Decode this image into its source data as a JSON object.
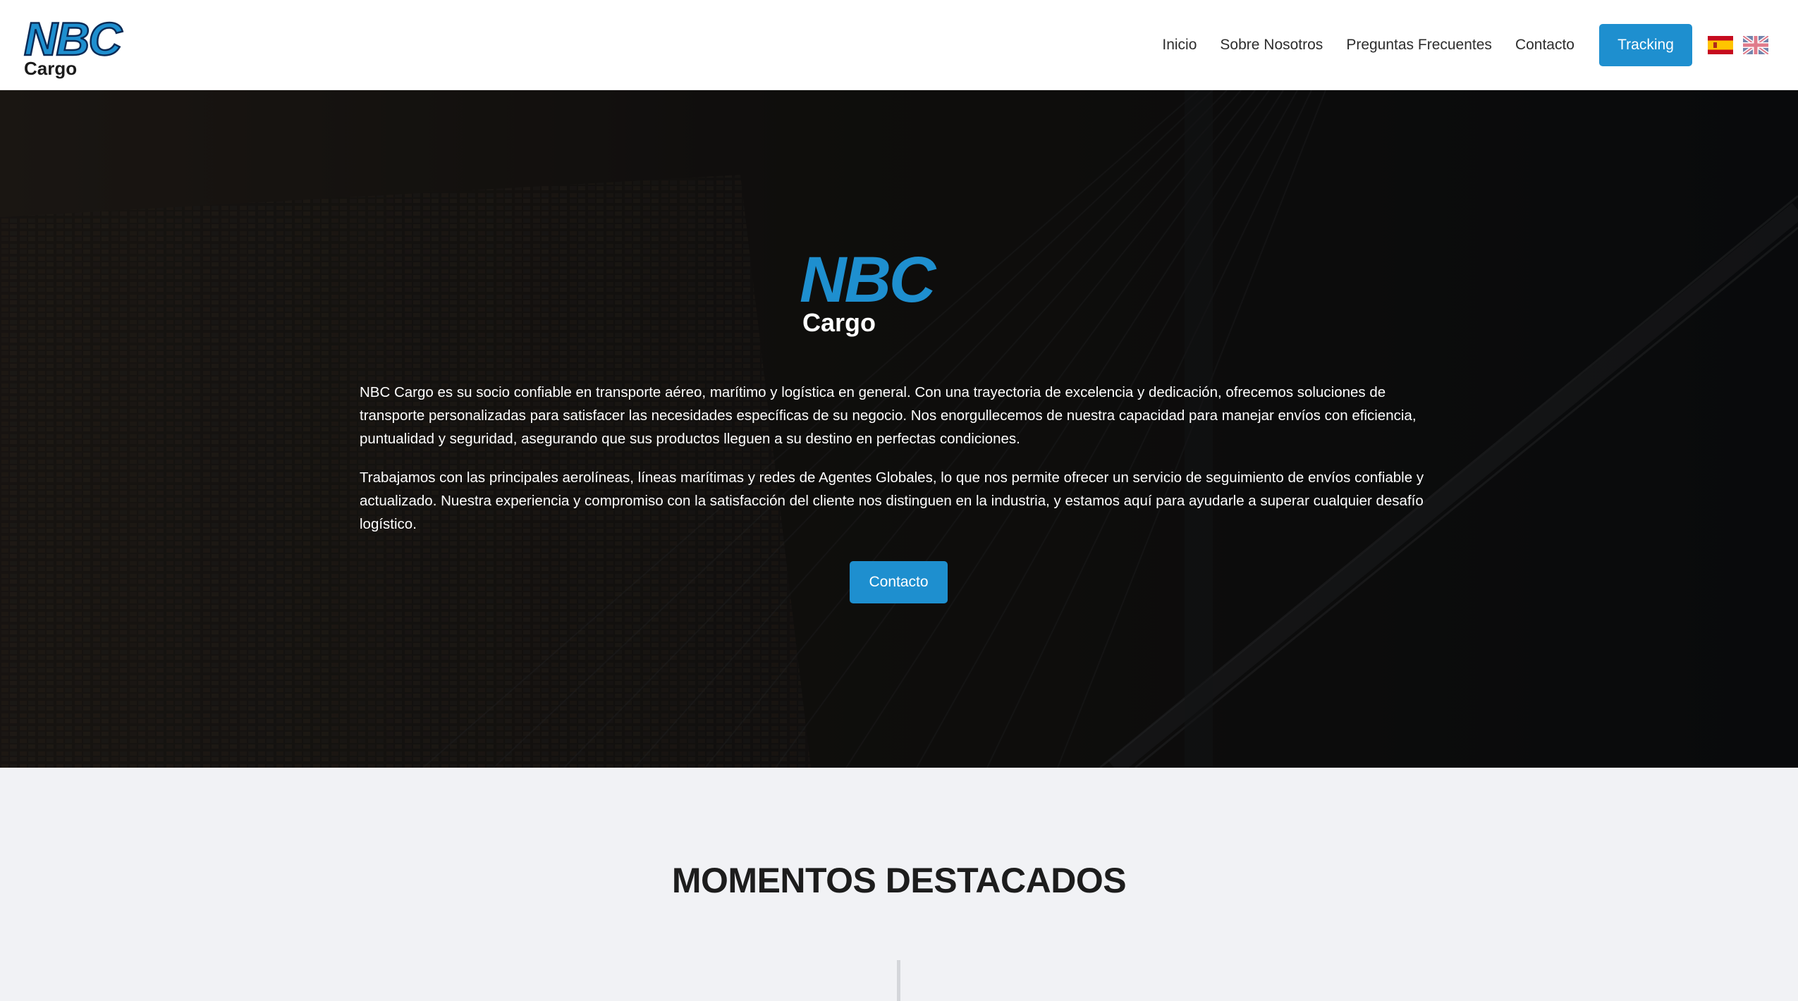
{
  "brand": {
    "logo_main": "NBC",
    "logo_sub": "Cargo",
    "primary_color": "#1e8fcf"
  },
  "nav": {
    "items": [
      {
        "label": "Inicio"
      },
      {
        "label": "Sobre Nosotros"
      },
      {
        "label": "Preguntas Frecuentes"
      },
      {
        "label": "Contacto"
      }
    ],
    "tracking_label": "Tracking",
    "languages": [
      {
        "icon": "spain-flag-icon"
      },
      {
        "icon": "uk-flag-icon"
      }
    ]
  },
  "hero": {
    "logo_main": "NBC",
    "logo_sub": "Cargo",
    "paragraphs": [
      "NBC Cargo es su socio confiable en transporte aéreo, marítimo y logística en general. Con una trayectoria de excelencia y dedicación, ofrecemos soluciones de transporte personalizadas para satisfacer las necesidades específicas de su negocio. Nos enorgullecemos de nuestra capacidad para manejar envíos con eficiencia, puntualidad y seguridad, asegurando que sus productos lleguen a su destino en perfectas condiciones.",
      "Trabajamos con las principales aerolíneas, líneas marítimas y redes de Agentes Globales, lo que nos permite ofrecer un servicio de seguimiento de envíos confiable y actualizado. Nuestra experiencia y compromiso con la satisfacción del cliente nos distinguen en la industria, y estamos aquí para ayudarle a superar cualquier desafío logístico."
    ],
    "button_label": "Contacto"
  },
  "highlights": {
    "title": "MOMENTOS DESTACADOS"
  }
}
